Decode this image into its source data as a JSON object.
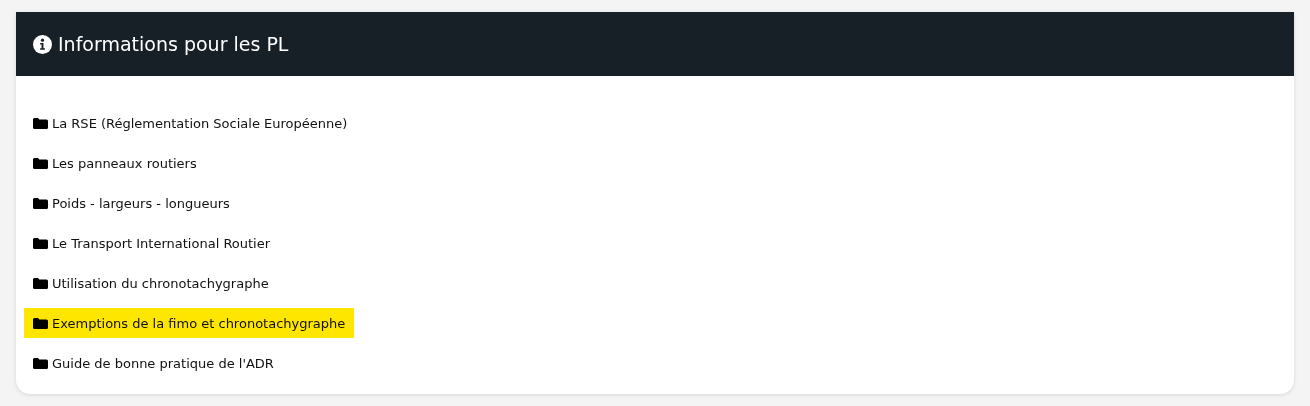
{
  "card": {
    "title": "Informations pour les PL",
    "items": [
      {
        "label": "La RSE (Réglementation Sociale Européenne)",
        "selected": false
      },
      {
        "label": "Les panneaux routiers",
        "selected": false
      },
      {
        "label": "Poids - largeurs - longueurs",
        "selected": false
      },
      {
        "label": "Le Transport International Routier",
        "selected": false
      },
      {
        "label": "Utilisation du chronotachygraphe",
        "selected": false
      },
      {
        "label": "Exemptions de la fimo et chronotachygraphe",
        "selected": true
      },
      {
        "label": "Guide de bonne pratique de l'ADR",
        "selected": false
      }
    ]
  }
}
